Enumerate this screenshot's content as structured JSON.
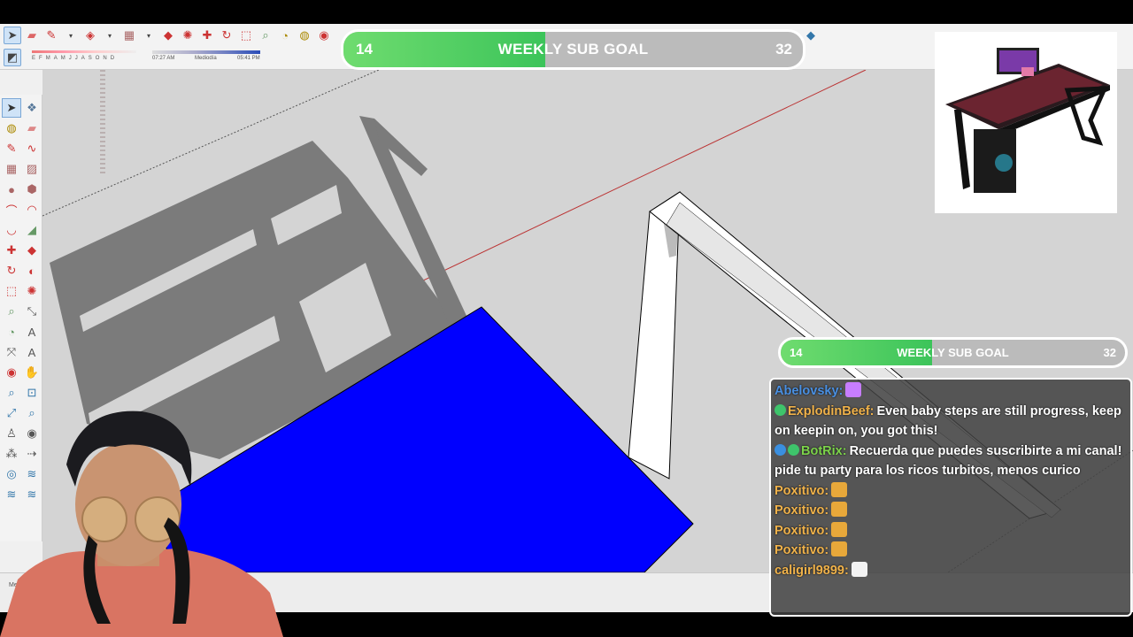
{
  "subgoal_top": {
    "current": "14",
    "title": "WEEKLY SUB GOAL",
    "target": "32",
    "progress_fraction": 0.44
  },
  "subgoal_side": {
    "current": "14",
    "title": "WEEKLY SUB GOAL",
    "target": "32",
    "progress_fraction": 0.44
  },
  "shadow_settings": {
    "months": [
      "E",
      "F",
      "M",
      "A",
      "M",
      "J",
      "J",
      "A",
      "S",
      "O",
      "N",
      "D"
    ],
    "time_start": "07:27 AM",
    "time_mid": "Mediodía",
    "time_end": "05:41 PM"
  },
  "status_bar": {
    "label": "Med"
  },
  "chat": {
    "messages": [
      {
        "user": "Abelovsky:",
        "color": "#4a90e2",
        "text": "",
        "badges": [],
        "emote": "sparkle"
      },
      {
        "user": "ExplodinBeef:",
        "color": "#f0b24a",
        "text": "Even baby steps are still progress, keep on keepin on, you got this!",
        "badges": [
          "green-badge"
        ],
        "emote": ""
      },
      {
        "user": "BotRix:",
        "color": "#7cd34a",
        "text": "Recuerda que puedes suscribirte a mi canal! pide tu party para los ricos turbitos, menos curico",
        "badges": [
          "blue-badge",
          "green-badge"
        ],
        "emote": ""
      },
      {
        "user": "Poxitivo:",
        "color": "#f0b24a",
        "text": "",
        "badges": [],
        "emote": "naruto"
      },
      {
        "user": "Poxitivo:",
        "color": "#f0b24a",
        "text": "",
        "badges": [],
        "emote": "naruto"
      },
      {
        "user": "Poxitivo:",
        "color": "#f0b24a",
        "text": "",
        "badges": [],
        "emote": "naruto"
      },
      {
        "user": "Poxitivo:",
        "color": "#f0b24a",
        "text": "",
        "badges": [],
        "emote": "naruto"
      },
      {
        "user": "caligirl9899:",
        "color": "#f0b24a",
        "text": "",
        "badges": [],
        "emote": "sign"
      }
    ]
  },
  "colors": {
    "face_blue": "#0000ff",
    "goal_green": "#4fd06a",
    "viewport_bg": "#d4d4d4",
    "shadow": "#7b7b7b"
  },
  "icons": {
    "top_toolbar": [
      "select-arrow-icon",
      "eraser-icon",
      "pencil-icon",
      "shape-icon",
      "paint-bucket-icon",
      "push-pull-icon",
      "follow-me-icon",
      "move-icon",
      "rotate-icon",
      "scale-icon",
      "tape-measure-icon",
      "orbit-icon",
      "pan-icon",
      "zoom-icon"
    ],
    "left_toolbar": [
      "select-icon",
      "component-icon",
      "paint-icon",
      "eraser-icon",
      "line-icon",
      "freehand-icon",
      "rectangle-icon",
      "rotated-rectangle-icon",
      "circle-icon",
      "polygon-icon",
      "arc-icon",
      "pie-icon",
      "two-point-arc-icon",
      "three-point-arc-icon",
      "move-icon",
      "push-pull-icon",
      "rotate-icon",
      "follow-me-icon",
      "scale-icon",
      "offset-icon",
      "tape-icon",
      "dimension-icon",
      "protractor-icon",
      "text-icon",
      "axes-icon",
      "3d-text-icon",
      "orbit-icon",
      "pan-icon",
      "zoom-icon",
      "zoom-window-icon",
      "zoom-extents-icon",
      "previous-view-icon",
      "position-camera-icon",
      "look-around-icon",
      "walk-icon",
      "section-icon",
      "sandbox-icon",
      "stamp-icon",
      "drape-icon",
      "flip-icon"
    ]
  }
}
